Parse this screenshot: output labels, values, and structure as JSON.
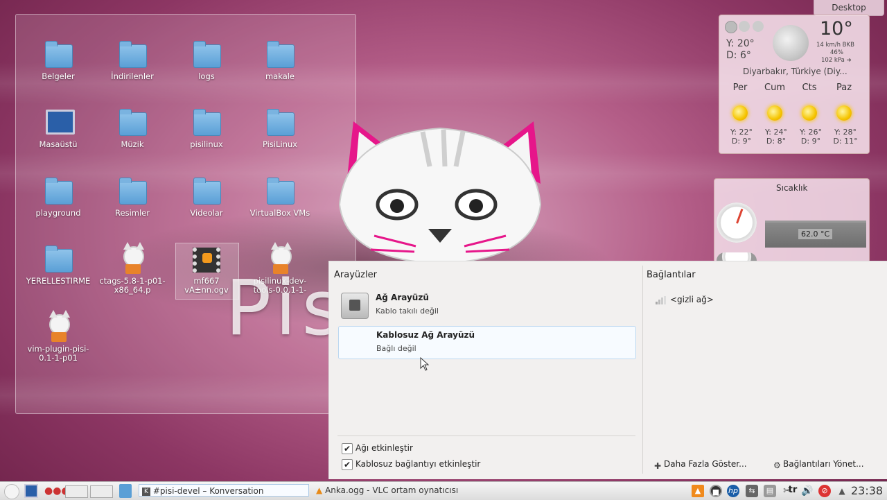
{
  "desktop": {
    "label": "Desktop"
  },
  "folderview": {
    "icons": [
      {
        "label": "Belgeler",
        "type": "folder"
      },
      {
        "label": "İndirilenler",
        "type": "folder"
      },
      {
        "label": "logs",
        "type": "folder"
      },
      {
        "label": "makale",
        "type": "folder"
      },
      {
        "label": "Masaüstü",
        "type": "monitor"
      },
      {
        "label": "Müzik",
        "type": "folder"
      },
      {
        "label": "pisilinux",
        "type": "folder"
      },
      {
        "label": "PisiLinux",
        "type": "folder"
      },
      {
        "label": "playground",
        "type": "folder"
      },
      {
        "label": "Resimler",
        "type": "folder"
      },
      {
        "label": "Videolar",
        "type": "folder"
      },
      {
        "label": "VirtualBox VMs",
        "type": "folder"
      },
      {
        "label": "YERELLESTIRME",
        "type": "folder"
      },
      {
        "label": "ctags-5.8-1-p01-x86_64.p",
        "type": "package"
      },
      {
        "label": "mf667 vA±nn.ogv",
        "type": "video"
      },
      {
        "label": "pisilinux-dev-tools-0.0.1-1-",
        "type": "package"
      },
      {
        "label": "vim-plugin-pisi-0.1-1-p01",
        "type": "package"
      }
    ]
  },
  "wallpaper": {
    "logo_text": "Pis"
  },
  "weather": {
    "current_temp": "10°",
    "today_high": "Y: 20°",
    "today_low": "D: 6°",
    "wind": "14 km/h BKB",
    "humidity": "46%",
    "pressure": "102 kPa ➔",
    "location": "Diyarbakır, Türkiye (Diy...",
    "forecast": [
      {
        "day": "Per",
        "high": "Y: 22°",
        "low": "D: 9°",
        "icon": "sun-icon"
      },
      {
        "day": "Cum",
        "high": "Y: 24°",
        "low": "D: 8°",
        "icon": "sun-icon"
      },
      {
        "day": "Cts",
        "high": "Y: 26°",
        "low": "D: 9°",
        "icon": "sun-icon"
      },
      {
        "day": "Paz",
        "high": "Y: 28°",
        "low": "D: 11°",
        "icon": "sun-icon"
      }
    ]
  },
  "temperature": {
    "title": "Sıcaklık",
    "reading": "62.0 °C"
  },
  "network": {
    "interfaces_title": "Arayüzler",
    "connections_title": "Bağlantılar",
    "interfaces": [
      {
        "name": "Ağ Arayüzü",
        "status": "Kablo takılı değil"
      },
      {
        "name": "Kablosuz Ağ Arayüzü",
        "status": "Bağlı değil"
      }
    ],
    "connections": [
      {
        "name": "<gizli ağ>"
      }
    ],
    "options": [
      {
        "label": "Ağı etkinleştir",
        "checked": true
      },
      {
        "label": "Kablosuz bağlantıyı etkinleştir",
        "checked": true
      }
    ],
    "more_button": "Daha Fazla Göster...",
    "manage_button": "Bağlantıları Yönet..."
  },
  "taskbar": {
    "tasks": [
      {
        "label": "#pisi-devel – Konversation"
      },
      {
        "label": "Anka.ogg - VLC ortam oynatıcısı"
      }
    ],
    "keyboard_layout": "tr",
    "clock": "23:38"
  },
  "colors": {
    "accent": "#b45e88",
    "sun": "#f5c400"
  }
}
